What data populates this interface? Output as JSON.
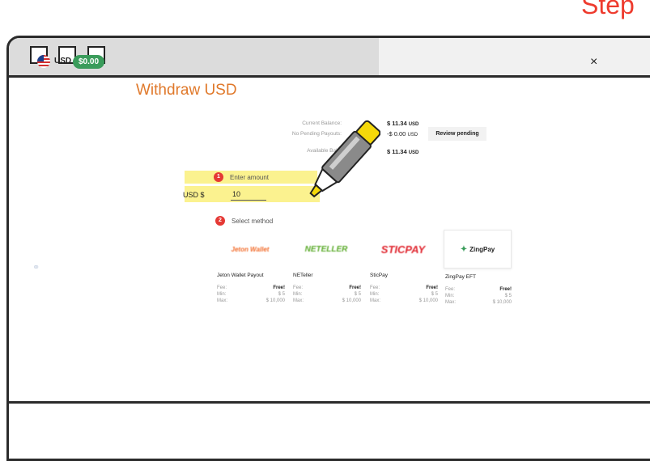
{
  "step_title": "Step",
  "window": {
    "buttons": [
      "minimize",
      "maximize",
      "close"
    ]
  },
  "header": {
    "currency": "USD",
    "balance_badge": "$0.00",
    "close_label": "×"
  },
  "page": {
    "title": "Withdraw USD"
  },
  "balances": {
    "current_label": "Current Balance:",
    "current_value": "$ 11.34",
    "current_unit": "USD",
    "pending_label": "No Pending Payouts:",
    "pending_value": "-$ 0.00",
    "pending_unit": "USD",
    "review_button": "Review pending",
    "available_label": "Available Bal...",
    "available_value": "$ 11.34",
    "available_unit": "USD"
  },
  "step1": {
    "number": "1",
    "label": "Enter amount",
    "prefix": "USD $",
    "amount": "10"
  },
  "step2": {
    "number": "2",
    "label": "Select method"
  },
  "methods": [
    {
      "logo": "Jeton Wallet",
      "name": "Jeton Wallet Payout",
      "fee_label": "Fee:",
      "fee": "Free!",
      "min_label": "Min:",
      "min": "$ 5",
      "max_label": "Max:",
      "max": "$ 10,000",
      "logo_color": "#f26b2a"
    },
    {
      "logo": "NETELLER",
      "name": "NETeller",
      "fee_label": "Fee:",
      "fee": "Free!",
      "min_label": "Min:",
      "min": "$ 5",
      "max_label": "Max:",
      "max": "$ 10,000",
      "logo_color": "#5aaa2a"
    },
    {
      "logo": "STICPAY",
      "name": "SticPay",
      "fee_label": "Fee:",
      "fee": "Free!",
      "min_label": "Min:",
      "min": "$ 5",
      "max_label": "Max:",
      "max": "$ 10,000",
      "logo_color": "#e0262f"
    },
    {
      "logo": "ZingPay",
      "name": "ZingPay EFT",
      "fee_label": "Fee:",
      "fee": "Free!",
      "min_label": "Min:",
      "min": "$ 5",
      "max_label": "Max:",
      "max": "$ 10,000",
      "logo_color": "#222222"
    }
  ],
  "colors": {
    "accent": "#e0792b",
    "badge": "#3a9c5b",
    "step": "#e53935",
    "highlight": "#fbf28f",
    "pen": "#f5d90a"
  },
  "icons": {
    "flag": "us-flag-icon",
    "pen": "highlighter-pen-icon",
    "link": "link-icon"
  }
}
